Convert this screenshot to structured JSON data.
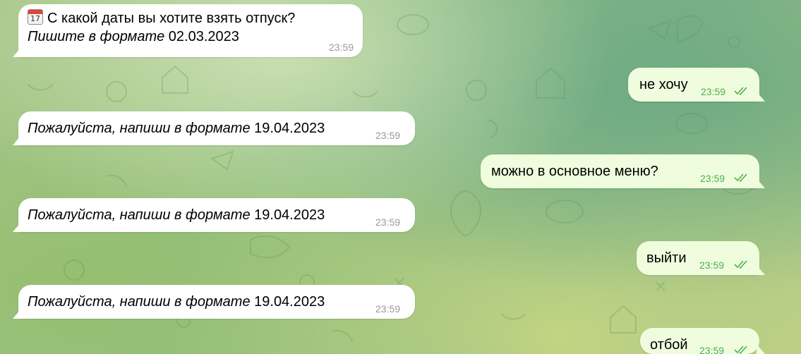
{
  "messages": [
    {
      "id": "bot-question",
      "direction": "in",
      "icon": "calendar-icon",
      "icon_text": "17",
      "line1": "С какой даты вы хотите взять отпуск?",
      "line2_italic": "Пишите в формате",
      "line2_plain": " 02.03.2023",
      "time": "23:59"
    },
    {
      "id": "user-ne-hochu",
      "direction": "out",
      "text": "не хочу",
      "time": "23:59",
      "status": "read"
    },
    {
      "id": "bot-format-1",
      "direction": "in",
      "text_italic": "Пожалуйста, напиши в формате",
      "text_plain": " 19.04.2023",
      "time": "23:59"
    },
    {
      "id": "user-menu",
      "direction": "out",
      "text": "можно в основное меню?",
      "time": "23:59",
      "status": "read"
    },
    {
      "id": "bot-format-2",
      "direction": "in",
      "text_italic": "Пожалуйста, напиши в формате",
      "text_plain": " 19.04.2023",
      "time": "23:59"
    },
    {
      "id": "user-exit",
      "direction": "out",
      "text": "выйти",
      "time": "23:59",
      "status": "read"
    },
    {
      "id": "bot-format-3",
      "direction": "in",
      "text_italic": "Пожалуйста, напиши в формате",
      "text_plain": " 19.04.2023",
      "time": "23:59"
    },
    {
      "id": "user-otboy",
      "direction": "out",
      "text": "отбой",
      "time": "23:59",
      "status": "read"
    }
  ],
  "colors": {
    "incoming_bubble": "#ffffff",
    "outgoing_bubble": "#effdde",
    "outgoing_time": "#4fae4e",
    "incoming_time": "#9a9a9a"
  }
}
